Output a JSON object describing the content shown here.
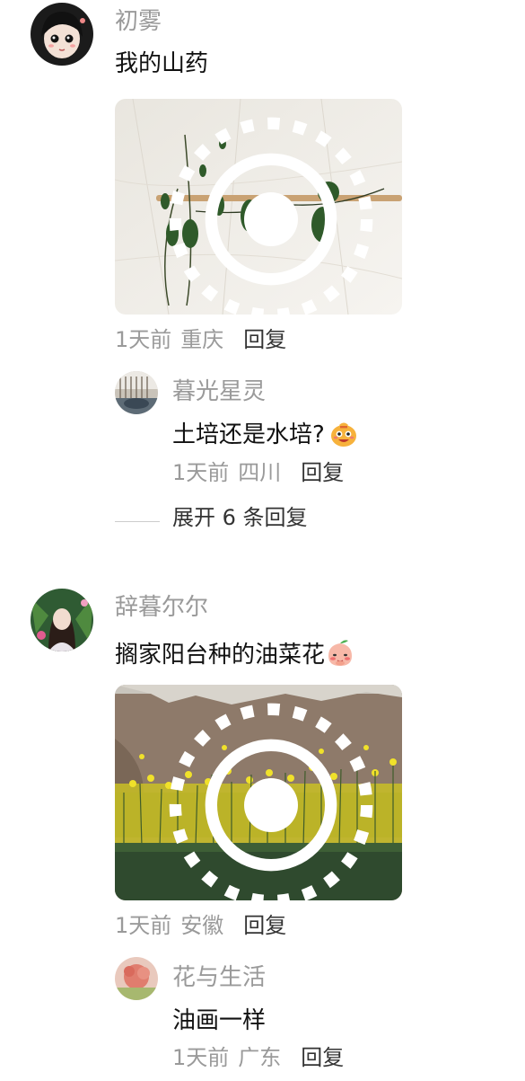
{
  "comments": [
    {
      "username": "初雾",
      "text": "我的山药",
      "time": "1天前",
      "location": "重庆",
      "reply_label": "回复",
      "photo_icon": "live-photo-icon",
      "replies": [
        {
          "username": "暮光星灵",
          "text": "土培还是水培?",
          "emoji": "money-bag-face-emoji",
          "time": "1天前",
          "location": "四川",
          "reply_label": "回复"
        }
      ],
      "expand_label": "展开 6 条回复"
    },
    {
      "username": "辞暮尔尔",
      "text": "搁家阳台种的油菜花",
      "emoji": "shy-peach-emoji",
      "time": "1天前",
      "location": "安徽",
      "reply_label": "回复",
      "photo_icon": "live-photo-icon",
      "replies": [
        {
          "username": "花与生活",
          "text": "油画一样",
          "time": "1天前",
          "location": "广东",
          "reply_label": "回复"
        }
      ]
    }
  ],
  "colors": {
    "username": "#9a9a9a",
    "text": "#111111",
    "reply": "#333333"
  }
}
